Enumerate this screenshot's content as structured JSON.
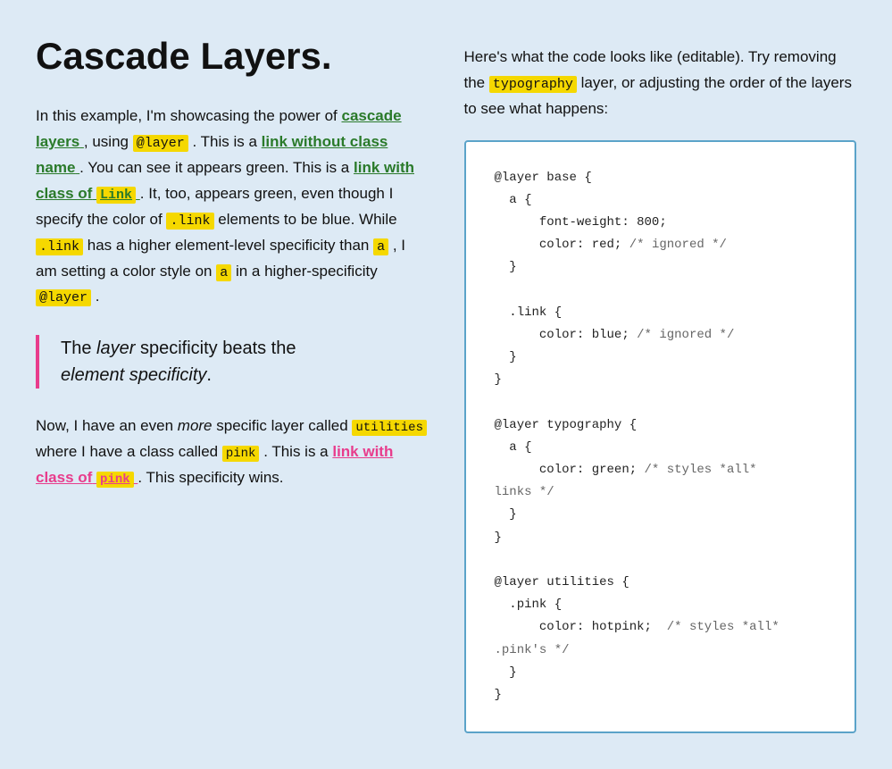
{
  "page": {
    "background": "#ddeaf5"
  },
  "left": {
    "title": "Cascade Layers.",
    "intro": {
      "part1": "In this example, I'm showcasing the power of",
      "cascade_layers_link": "cascade layers",
      "part2": ", using",
      "at_layer_code": "@layer",
      "part3": ". This is a",
      "link_no_class": "link without class name",
      "part4": ". You can see it appears green. This is a",
      "link_with_class": "link with class of",
      "link_code": "Link",
      "part5": ". It, too, appears green, even though I specify the color of",
      "dot_link_code1": ".link",
      "part6": "elements to be blue. While",
      "dot_link_code2": ".link",
      "part7": "has a higher element-level specificity than",
      "a_code": "a",
      "part8": ", I am setting a color style on",
      "a_code2": "a",
      "part9": "in a higher-specificity",
      "at_layer_code2": "@layer",
      "part10": "."
    },
    "blockquote": {
      "line1": "The",
      "layer_em": "layer",
      "line1b": "specificity beats the",
      "line2": "element specificity",
      "period": "."
    },
    "second_para": {
      "part1": "Now, I have an even",
      "more_em": "more",
      "part2": "specific layer called",
      "utilities_code": "utilities",
      "part3": "where I have a class called",
      "pink_code": "pink",
      "part4": ". This is a",
      "link_pink": "link with class of",
      "pink_highlight": "pink",
      "part5": ". This specificity wins."
    }
  },
  "right": {
    "description": {
      "part1": "Here's what the code looks like (editable). Try removing the",
      "typography_highlight": "typography",
      "part2": "layer, or adjusting the order of the layers to see what happens:"
    },
    "code": "@layer base {\n  a {\n      font-weight: 800;\n      color: red; /* ignored */\n  }\n\n  .link {\n      color: blue; /* ignored */\n  }\n}\n\n@layer typography {\n  a {\n      color: green; /* styles *all*\nlinks */\n  }\n}\n\n@layer utilities {\n  .pink {\n      color: hotpink;  /* styles *all*\n.pink's */\n  }\n}"
  }
}
